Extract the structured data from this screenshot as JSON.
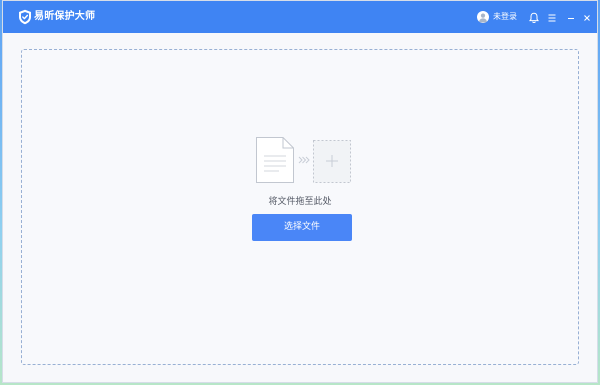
{
  "window": {
    "title": "易昕保护大师"
  },
  "titlebar": {
    "login_label": "未登录",
    "icons": [
      "shield-logo-icon",
      "user-avatar-icon",
      "bell-icon",
      "menu-icon",
      "minimize-icon",
      "close-icon"
    ]
  },
  "main": {
    "drop_hint": "将文件拖至此处",
    "select_button_label": "选择文件",
    "illustration_icons": [
      "document-icon",
      "arrow-right-icon",
      "add-file-icon"
    ]
  },
  "colors": {
    "accent": "#3f84f3",
    "button": "#4a86f7",
    "background": "#f8f9fc",
    "dashed_border": "#98b0d4"
  }
}
